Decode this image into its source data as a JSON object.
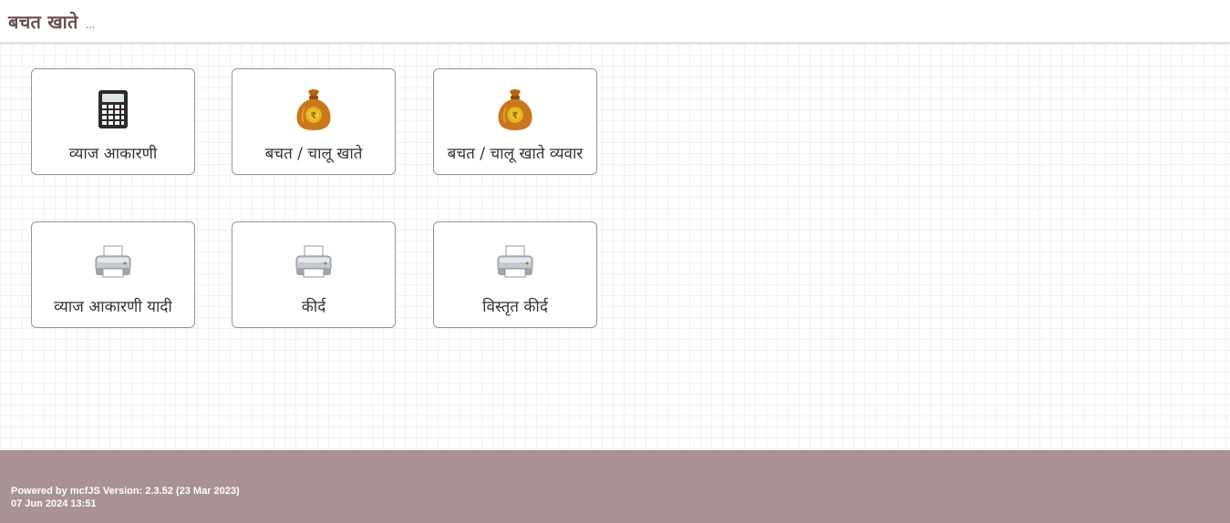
{
  "header": {
    "title": "बचत खाते",
    "ellipsis": "..."
  },
  "tiles": [
    {
      "label": "व्याज आकारणी",
      "icon": "calculator-icon"
    },
    {
      "label": "बचत / चालू खाते",
      "icon": "money-bag-icon"
    },
    {
      "label": "बचत / चालू खाते व्यवार",
      "icon": "money-bag-icon"
    },
    {
      "label": "व्याज आकारणी यादी",
      "icon": "printer-icon"
    },
    {
      "label": "कीर्द",
      "icon": "printer-icon"
    },
    {
      "label": "विस्तृत कीर्द",
      "icon": "printer-icon"
    }
  ],
  "footer": {
    "powered_by": "Powered by mcfJS Version: 2.3.52 (23 Mar 2023)",
    "timestamp": "07 Jun 2024 13:51"
  },
  "colors": {
    "title": "#6b4e4e",
    "tile_border": "#a58a95",
    "footer_bg": "#a99293",
    "bag": "#c9771a",
    "coin": "#f2c230"
  }
}
